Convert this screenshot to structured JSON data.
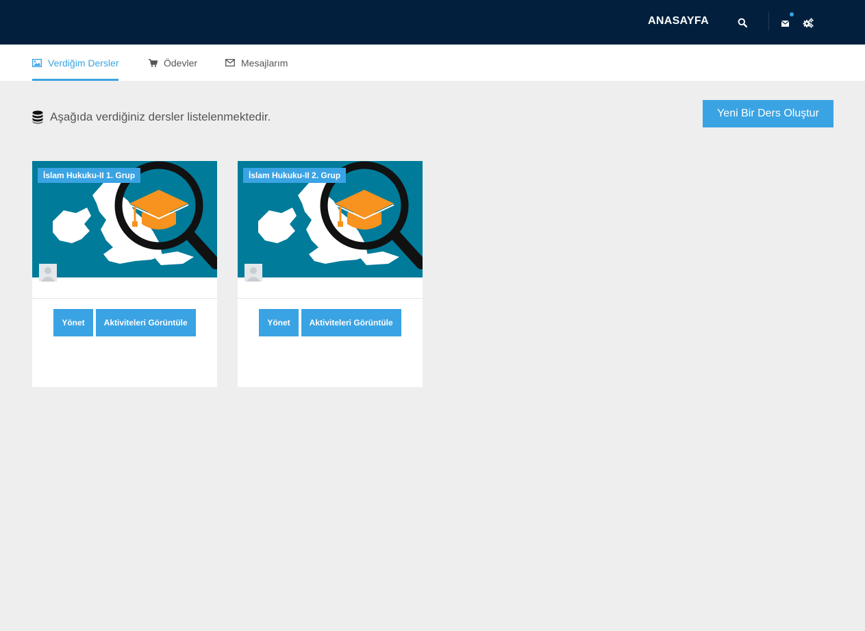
{
  "header": {
    "home_label": "ANASAYFA",
    "search_icon": "search-icon",
    "mail_icon": "envelope-icon",
    "settings_icon": "gears-icon",
    "has_notification": true
  },
  "tabs": [
    {
      "label": "Verdiğim Dersler",
      "icon": "image-icon",
      "active": true
    },
    {
      "label": "Ödevler",
      "icon": "shopping-cart-icon",
      "active": false
    },
    {
      "label": "Mesajlarım",
      "icon": "envelope-outline-icon",
      "active": false
    }
  ],
  "main": {
    "info_text": "Aşağıda verdiğiniz dersler listelenmektedir.",
    "info_icon": "database-icon",
    "new_course_label": "Yeni Bir Ders Oluştur"
  },
  "courses": [
    {
      "title": "İslam Hukuku-II 1. Grup",
      "manage_label": "Yönet",
      "activities_label": "Aktiviteleri Görüntüle"
    },
    {
      "title": "İslam Hukuku-II 2. Grup",
      "manage_label": "Yönet",
      "activities_label": "Aktiviteleri Görüntüle"
    }
  ],
  "colors": {
    "topbar": "#02203e",
    "accent": "#3aa3e3",
    "card_image_bg": "#007b99",
    "page_bg": "#eeeeee"
  }
}
